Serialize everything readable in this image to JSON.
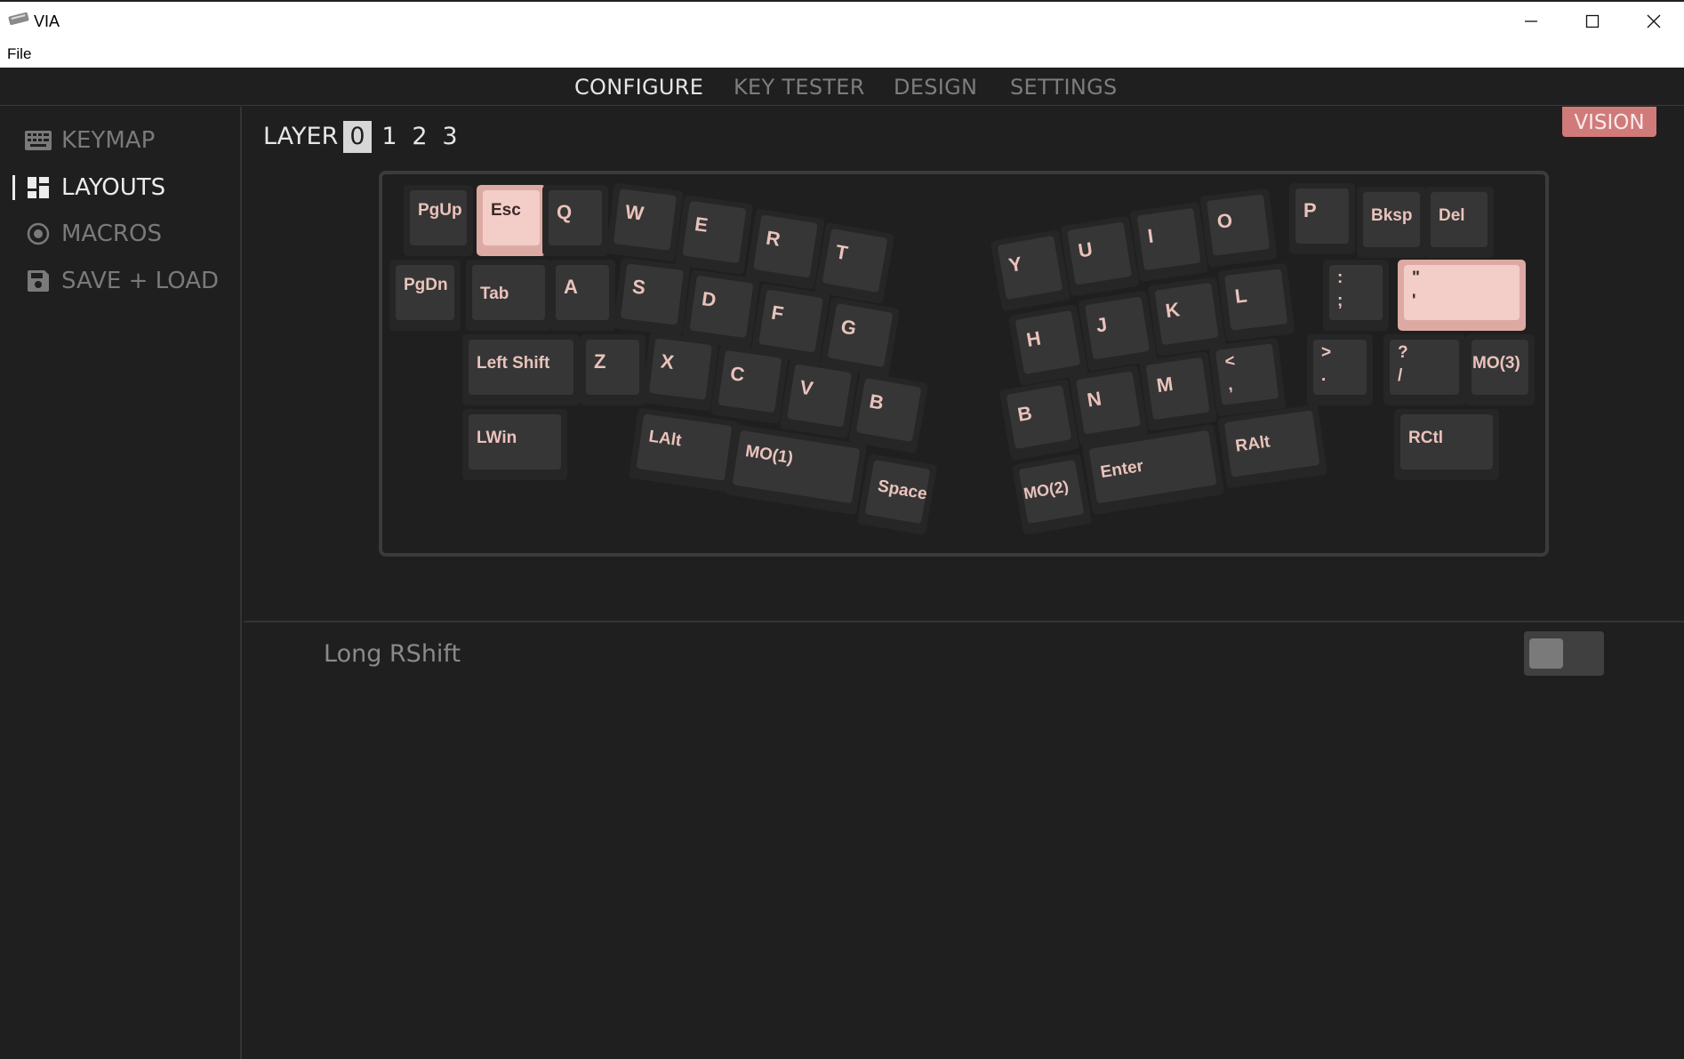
{
  "window": {
    "title": "VIA"
  },
  "menu": {
    "file": "File"
  },
  "nav": {
    "tabs": [
      "CONFIGURE",
      "KEY TESTER",
      "DESIGN",
      "SETTINGS"
    ]
  },
  "sidebar": {
    "items": [
      "KEYMAP",
      "LAYOUTS",
      "MACROS",
      "SAVE + LOAD"
    ]
  },
  "layers": {
    "label": "LAYER",
    "options": [
      "0",
      "1",
      "2",
      "3"
    ],
    "selected": "0"
  },
  "keyboard": {
    "name": "VISION"
  },
  "keys": {
    "pgup": "PgUp",
    "esc": "Esc",
    "q": "Q",
    "w": "W",
    "e": "E",
    "r": "R",
    "t": "T",
    "y": "Y",
    "u": "U",
    "i": "I",
    "o": "O",
    "p": "P",
    "bksp": "Bksp",
    "del": "Del",
    "pgdn": "PgDn",
    "tab": "Tab",
    "a": "A",
    "s": "S",
    "d": "D",
    "f": "F",
    "g": "G",
    "h": "H",
    "j": "J",
    "k": "K",
    "l": "L",
    "semicolon": ":\n;",
    "quote": "\"\n'",
    "lshift": "Left Shift",
    "z": "Z",
    "x": "X",
    "c": "C",
    "v": "V",
    "b_left": "B",
    "b_right": "B",
    "n": "N",
    "m": "M",
    "comma": "<\n,",
    "period": ">\n.",
    "slash": "?\n/",
    "mo3": "MO(3)",
    "lwin": "LWin",
    "lalt": "LAlt",
    "mo1": "MO(1)",
    "space": "Space",
    "mo2": "MO(2)",
    "enter": "Enter",
    "ralt": "RAlt",
    "rctl": "RCtl"
  },
  "options": {
    "long_rshift": {
      "label": "Long RShift",
      "enabled": false
    }
  },
  "colors": {
    "accent": "#d07a7a",
    "keycap_text": "#eac3bc",
    "highlight_key": "#f3cec8",
    "background": "#1f1f1f"
  }
}
